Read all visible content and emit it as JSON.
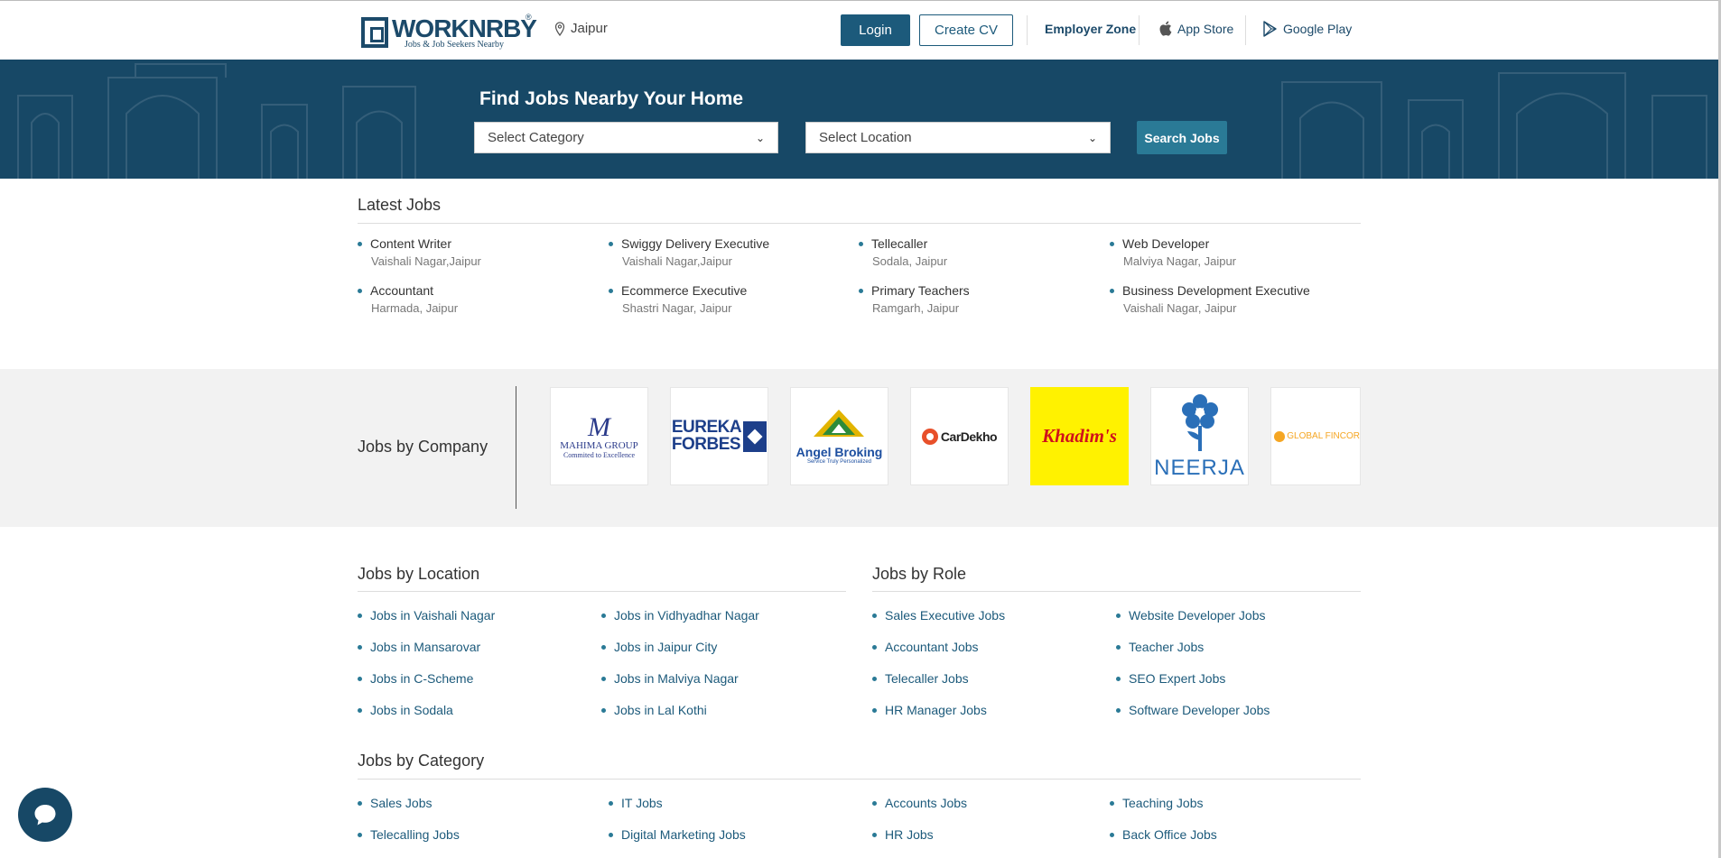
{
  "header": {
    "brand": "WORKNRBY",
    "brand_reg": "®",
    "tagline": "Jobs & Job Seekers Nearby",
    "location": "Jaipur",
    "login_label": "Login",
    "create_cv_label": "Create CV",
    "employer_zone_label": "Employer Zone",
    "app_store_label": "App Store",
    "google_play_label": "Google Play"
  },
  "hero": {
    "title": "Find Jobs Nearby Your Home",
    "category_placeholder": "Select Category",
    "location_placeholder": "Select Location",
    "search_label": "Search Jobs"
  },
  "latest_jobs": {
    "title": "Latest Jobs",
    "items": [
      {
        "title": "Content Writer",
        "location": "Vaishali Nagar,Jaipur"
      },
      {
        "title": "Swiggy Delivery Executive",
        "location": "Vaishali Nagar,Jaipur"
      },
      {
        "title": "Tellecaller",
        "location": "Sodala, Jaipur"
      },
      {
        "title": "Web Developer",
        "location": "Malviya Nagar, Jaipur"
      },
      {
        "title": "Accountant",
        "location": "Harmada, Jaipur"
      },
      {
        "title": "Ecommerce Executive",
        "location": "Shastri Nagar, Jaipur"
      },
      {
        "title": "Primary Teachers",
        "location": "Ramgarh, Jaipur"
      },
      {
        "title": "Business Development Executive",
        "location": "Vaishali Nagar, Jaipur"
      }
    ]
  },
  "companies": {
    "title": "Jobs by Company",
    "logos": [
      {
        "name": "Mahima Group",
        "line1": "M",
        "line2": "MAHIMA GROUP",
        "line3": "Commited to Excellence"
      },
      {
        "name": "Eureka Forbes",
        "line1": "EUREKA",
        "line2": "FORBES"
      },
      {
        "name": "Angel Broking",
        "line1": "Angel Broking",
        "line2": "Service Truly Personalized"
      },
      {
        "name": "CarDekho",
        "line1": "CarDekho"
      },
      {
        "name": "Khadim's",
        "line1": "Khadim's"
      },
      {
        "name": "Neerja",
        "line1": "NEERJA"
      },
      {
        "name": "Global Fincorp",
        "line1": "GLOBAL FINCOR"
      }
    ]
  },
  "by_location": {
    "title": "Jobs by Location",
    "items": [
      "Jobs in Vaishali Nagar",
      "Jobs in Vidhyadhar Nagar",
      "Jobs in Mansarovar",
      "Jobs in Jaipur City",
      "Jobs in C-Scheme",
      "Jobs in Malviya Nagar",
      "Jobs in Sodala",
      "Jobs in Lal Kothi"
    ]
  },
  "by_role": {
    "title": "Jobs by Role",
    "items": [
      "Sales Executive Jobs",
      "Website Developer Jobs",
      "Accountant Jobs",
      "Teacher Jobs",
      "Telecaller Jobs",
      "SEO Expert Jobs",
      "HR Manager Jobs",
      "Software Developer Jobs"
    ]
  },
  "by_category": {
    "title": "Jobs by Category",
    "items": [
      "Sales Jobs",
      "IT Jobs",
      "Accounts Jobs",
      "Teaching Jobs",
      "Telecalling Jobs",
      "Digital Marketing Jobs",
      "HR Jobs",
      "Back Office Jobs"
    ]
  },
  "colors": {
    "primary": "#174866",
    "accent": "#2a7a96",
    "khadims_bg": "#fff200"
  }
}
